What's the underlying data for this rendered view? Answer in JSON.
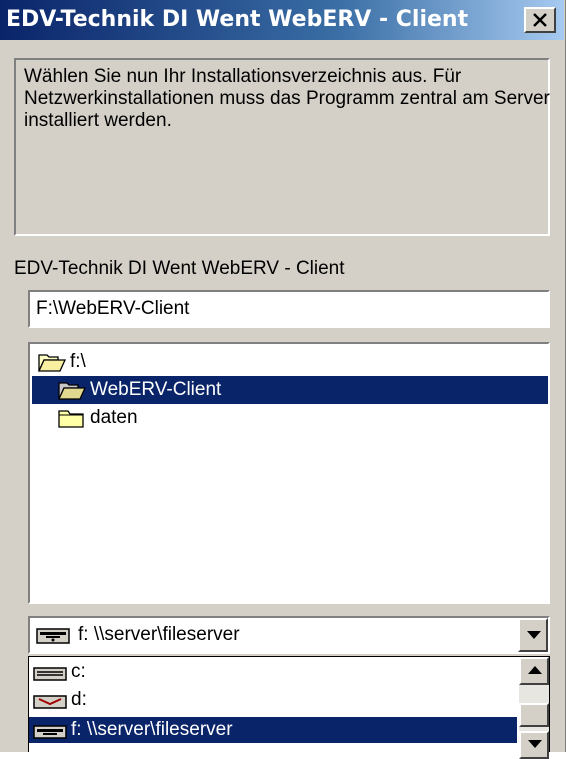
{
  "window": {
    "title": "EDV-Technik DI Went WebERV - Client",
    "close_icon": "close-icon"
  },
  "description": "Wählen Sie nun Ihr Installationsverzeichnis aus. Für Netzwerkinstallationen muss das Programm zentral am Server installiert werden.",
  "section_label": "EDV-Technik DI Went WebERV - Client",
  "path_input": {
    "value": "F:\\WebERV-Client"
  },
  "folder_tree": {
    "items": [
      {
        "label": "f:\\",
        "icon": "folder-open-icon",
        "selected": false,
        "depth": 0
      },
      {
        "label": "WebERV-Client",
        "icon": "folder-open-icon",
        "selected": true,
        "depth": 1
      },
      {
        "label": "daten",
        "icon": "folder-icon",
        "selected": false,
        "depth": 1
      }
    ]
  },
  "drive_select": {
    "value": "f:  \\\\server\\fileserver",
    "icon": "network-drive-icon",
    "options": [
      {
        "label": "c:",
        "icon": "hard-drive-icon",
        "selected": false
      },
      {
        "label": "d:",
        "icon": "cd-drive-icon",
        "selected": false
      },
      {
        "label": "f:  \\\\server\\fileserver",
        "icon": "network-drive-icon",
        "selected": true
      }
    ]
  },
  "colors": {
    "title_bar": "#0a246a",
    "selection": "#0a246a",
    "dialog_face": "#d4d0c8"
  }
}
